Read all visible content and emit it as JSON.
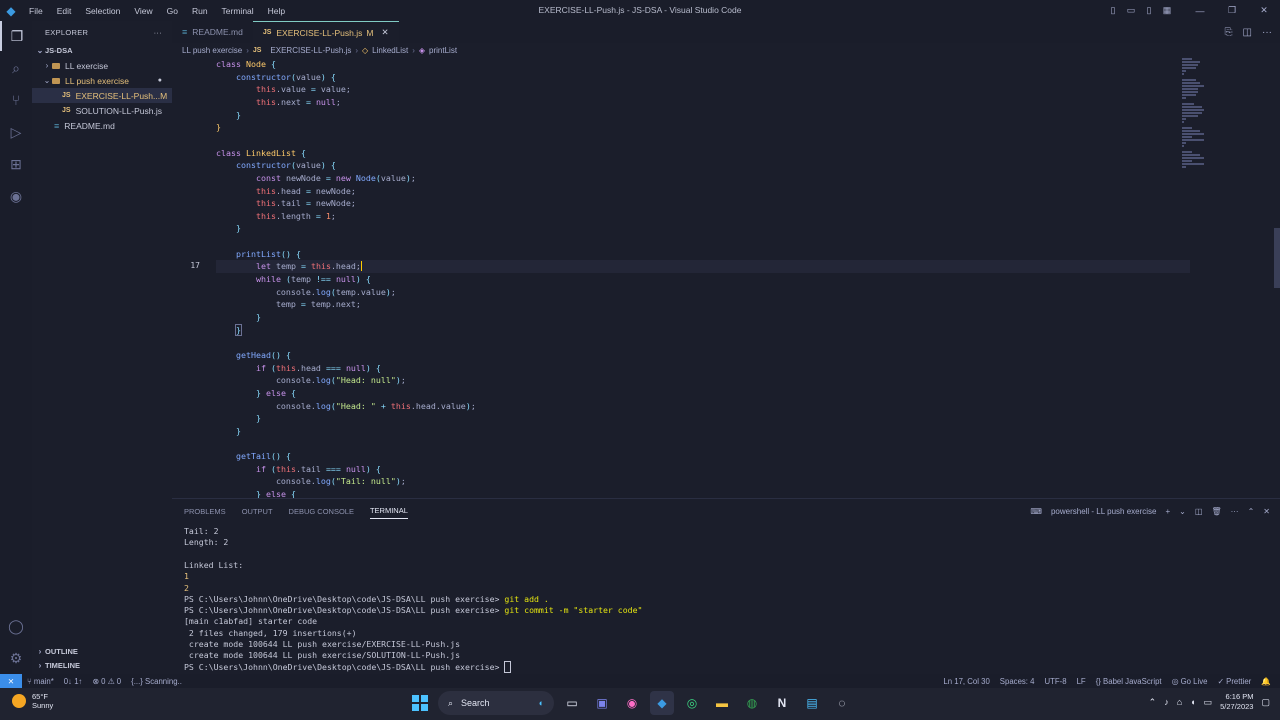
{
  "window": {
    "title": "EXERCISE-LL-Push.js - JS-DSA - Visual Studio Code",
    "menu": [
      "File",
      "Edit",
      "Selection",
      "View",
      "Go",
      "Run",
      "Terminal",
      "Help"
    ]
  },
  "sidebar": {
    "header": "EXPLORER",
    "root": "JS-DSA",
    "items": [
      {
        "label": "LL exercise",
        "kind": "folder",
        "chevron": "›"
      },
      {
        "label": "LL push exercise",
        "kind": "folder",
        "chevron": "⌄",
        "badge": "●"
      },
      {
        "label": "EXERCISE-LL-Push...",
        "kind": "js",
        "badge": "M"
      },
      {
        "label": "SOLUTION-LL-Push.js",
        "kind": "js"
      },
      {
        "label": "README.md",
        "kind": "md"
      }
    ],
    "outline": "OUTLINE",
    "timeline": "TIMELINE"
  },
  "tabs": [
    {
      "label": "README.md",
      "icon": "markdown-icon"
    },
    {
      "label": "EXERCISE-LL-Push.js",
      "modified": "M",
      "icon": "js-icon"
    }
  ],
  "breadcrumb": [
    "LL push exercise",
    "EXERCISE-LL-Push.js",
    "LinkedList",
    "printList"
  ],
  "editor": {
    "current_line": "17",
    "line_numbers": [
      "",
      "",
      "",
      "",
      "",
      "",
      "",
      "",
      "",
      "",
      "",
      "",
      "",
      "",
      "",
      "",
      "17",
      "",
      "",
      "",
      "",
      "",
      "",
      "",
      "",
      "",
      "",
      "",
      "",
      "",
      "",
      "",
      "",
      "",
      ""
    ]
  },
  "panel": {
    "tabs": [
      "PROBLEMS",
      "OUTPUT",
      "DEBUG CONSOLE",
      "TERMINAL"
    ],
    "shell": "powershell - LL push exercise",
    "terminal": {
      "l1": "Tail: 2",
      "l2": "Length: 2",
      "l3": "Linked List:",
      "l4": "1",
      "l5": "2",
      "l6_prompt": "PS C:\\Users\\Johnn\\OneDrive\\Desktop\\code\\JS-DSA\\LL push exercise>",
      "l6_cmd": "git add .",
      "l7_prompt": "PS C:\\Users\\Johnn\\OneDrive\\Desktop\\code\\JS-DSA\\LL push exercise>",
      "l7_cmd": "git commit -m \"starter code\"",
      "l8": "[main c1abfad] starter code",
      "l9": " 2 files changed, 179 insertions(+)",
      "l10": " create mode 100644 LL push exercise/EXERCISE-LL-Push.js",
      "l11": " create mode 100644 LL push exercise/SOLUTION-LL-Push.js",
      "l12_prompt": "PS C:\\Users\\Johnn\\OneDrive\\Desktop\\code\\JS-DSA\\LL push exercise>"
    }
  },
  "statusbar": {
    "branch": "main*",
    "sync": "0↓ 1↑",
    "errors": "⊗ 0 ⚠ 0",
    "scanning": "{...} Scanning..",
    "position": "Ln 17, Col 30",
    "spaces": "Spaces: 4",
    "encoding": "UTF-8",
    "eol": "LF",
    "language": "{} Babel JavaScript",
    "golive": "Go Live",
    "prettier": "✓ Prettier"
  },
  "taskbar": {
    "temp": "65°F",
    "condition": "Sunny",
    "search": "Search",
    "time": "6:16 PM",
    "date": "5/27/2023"
  }
}
